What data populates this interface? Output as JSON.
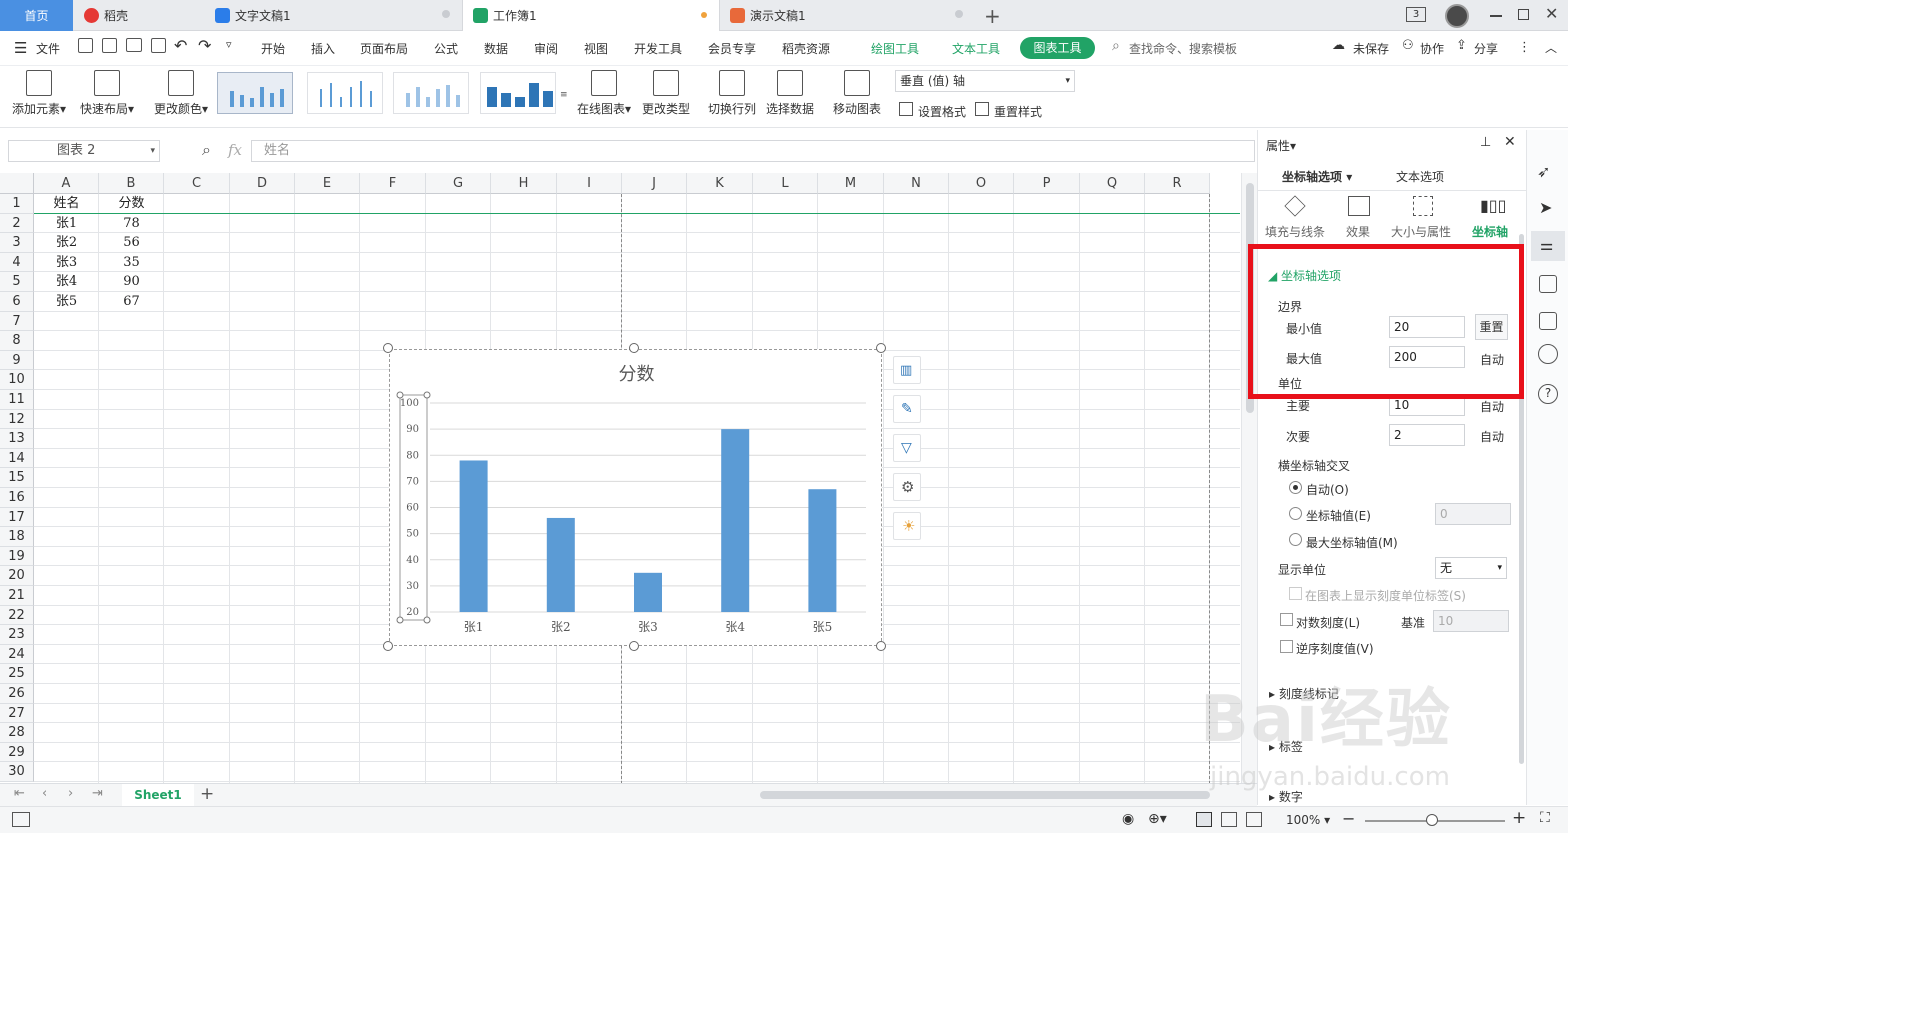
{
  "titlebar": {
    "tabs": [
      {
        "label": "首页"
      },
      {
        "label": "稻壳"
      },
      {
        "label": "文字文稿1"
      },
      {
        "label": "工作簿1"
      },
      {
        "label": "演示文稿1"
      }
    ],
    "new_tab": "+",
    "badge": "3"
  },
  "menubar": {
    "file": "文件",
    "items": [
      "开始",
      "插入",
      "页面布局",
      "公式",
      "数据",
      "审阅",
      "视图",
      "开发工具",
      "会员专享",
      "稻壳资源"
    ],
    "draw_tools": "绘图工具",
    "text_tools": "文本工具",
    "chart_tools": "图表工具",
    "search_placeholder": "查找命令、搜索模板",
    "unsaved": "未保存",
    "collab": "协作",
    "share": "分享"
  },
  "ribbon": {
    "add_element": "添加元素",
    "quick_layout": "快速布局",
    "change_color": "更改颜色",
    "online_chart": "在线图表",
    "change_type": "更改类型",
    "switch_rowcol": "切换行列",
    "select_data": "选择数据",
    "move_chart": "移动图表",
    "axis_select": "垂直 (值) 轴",
    "set_format": "设置格式",
    "reset_style": "重置样式"
  },
  "formula": {
    "namebox": "图表 2",
    "fx": "fx",
    "content": "姓名"
  },
  "sheet": {
    "columns": [
      "A",
      "B",
      "C",
      "D",
      "E",
      "F",
      "G",
      "H",
      "I",
      "J",
      "K",
      "L",
      "M",
      "N",
      "O",
      "P",
      "Q",
      "R"
    ],
    "rows": [
      "1",
      "2",
      "3",
      "4",
      "5",
      "6",
      "7",
      "8",
      "9",
      "10",
      "11",
      "12",
      "13",
      "14",
      "15",
      "16",
      "17",
      "18",
      "19",
      "20",
      "21",
      "22",
      "23",
      "24",
      "25",
      "26",
      "27",
      "28",
      "29",
      "30"
    ],
    "data": [
      [
        "姓名",
        "分数"
      ],
      [
        "张1",
        "78"
      ],
      [
        "张2",
        "56"
      ],
      [
        "张3",
        "35"
      ],
      [
        "张4",
        "90"
      ],
      [
        "张5",
        "67"
      ]
    ],
    "sheet_tab": "Sheet1"
  },
  "chart_data": {
    "type": "bar",
    "title": "分数",
    "categories": [
      "张1",
      "张2",
      "张3",
      "张4",
      "张5"
    ],
    "values": [
      78,
      56,
      35,
      90,
      67
    ],
    "ylim": [
      20,
      100
    ],
    "yticks": [
      "100",
      "90",
      "80",
      "70",
      "60",
      "50",
      "40",
      "30",
      "20"
    ],
    "color": "#5b9bd5",
    "grid": true
  },
  "panel": {
    "header": "属性",
    "tab_axis": "坐标轴选项",
    "tab_text": "文本选项",
    "sub_fill": "填充与线条",
    "sub_effect": "效果",
    "sub_size": "大小与属性",
    "sub_axis": "坐标轴",
    "section": "坐标轴选项",
    "bounds": "边界",
    "min_label": "最小值",
    "min_value": "20",
    "reset": "重置",
    "max_label": "最大值",
    "max_value": "200",
    "auto": "自动",
    "unit": "单位",
    "major_label": "主要",
    "major_value": "10",
    "minor_label": "次要",
    "minor_value": "2",
    "cross": "横坐标轴交叉",
    "cross_auto": "自动(O)",
    "cross_value": "坐标轴值(E)",
    "cross_value_input": "0",
    "cross_max": "最大坐标轴值(M)",
    "display_unit": "显示单位",
    "display_unit_value": "无",
    "show_unit_label": "在图表上显示刻度单位标签(S)",
    "log_scale": "对数刻度(L)",
    "base": "基准",
    "base_value": "10",
    "reverse": "逆序刻度值(V)",
    "tick_marks": "刻度线标记",
    "labels": "标签",
    "numbers": "数字"
  },
  "status": {
    "zoom": "100%"
  },
  "watermark": {
    "text": "Bai经验",
    "url": "jingyan.baidu.com"
  },
  "colors": {
    "accent": "#21a366",
    "tab_blue": "#4a90e2",
    "highlight": "#e8101a",
    "bar": "#5b9bd5"
  }
}
